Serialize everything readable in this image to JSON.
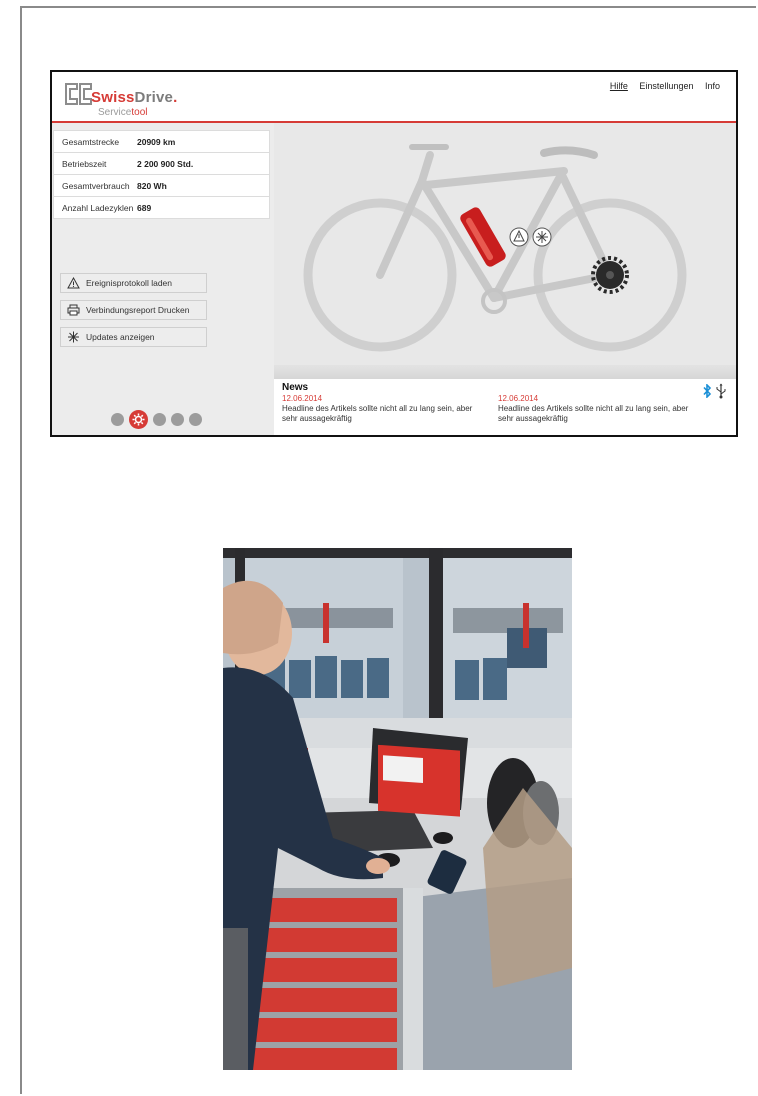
{
  "app": {
    "brand": {
      "prefix": "Swiss",
      "suffix": "Drive",
      "dot": ".",
      "sub_plain": "Service",
      "sub_accent": "tool"
    },
    "nav": [
      {
        "label": "Hilfe",
        "active": true
      },
      {
        "label": "Einstellungen",
        "active": false
      },
      {
        "label": "Info",
        "active": false
      }
    ],
    "stats": [
      {
        "label": "Gesamtstrecke",
        "value": "20909 km"
      },
      {
        "label": "Betriebszeit",
        "value": "2 200 900 Std."
      },
      {
        "label": "Gesamtverbrauch",
        "value": "820 Wh"
      },
      {
        "label": "Anzahl Ladezyklen",
        "value": "689"
      }
    ],
    "actions": [
      {
        "label": "Ereignisprotokoll laden",
        "icon": "warning-icon"
      },
      {
        "label": "Verbindungsreport Drucken",
        "icon": "printer-icon"
      },
      {
        "label": "Updates anzeigen",
        "icon": "asterisk-icon"
      }
    ],
    "pagination": {
      "count": 5,
      "active_index": 1
    },
    "news": {
      "title": "News",
      "items": [
        {
          "date": "12.06.2014",
          "headline": "Headline des Artikels sollte nicht all zu lang sein, aber sehr aussagekräftig"
        },
        {
          "date": "12.06.2014",
          "headline": "Headline des Artikels sollte nicht all zu lang sein, aber sehr aussagekräftig"
        }
      ],
      "status_icons": [
        "bluetooth-icon",
        "usb-icon"
      ]
    },
    "colors": {
      "accent": "#d63b36",
      "panel": "#ececec",
      "bike": "#cfcfcf"
    }
  },
  "photo": {
    "description_icon": "technician-workbench-photo"
  }
}
